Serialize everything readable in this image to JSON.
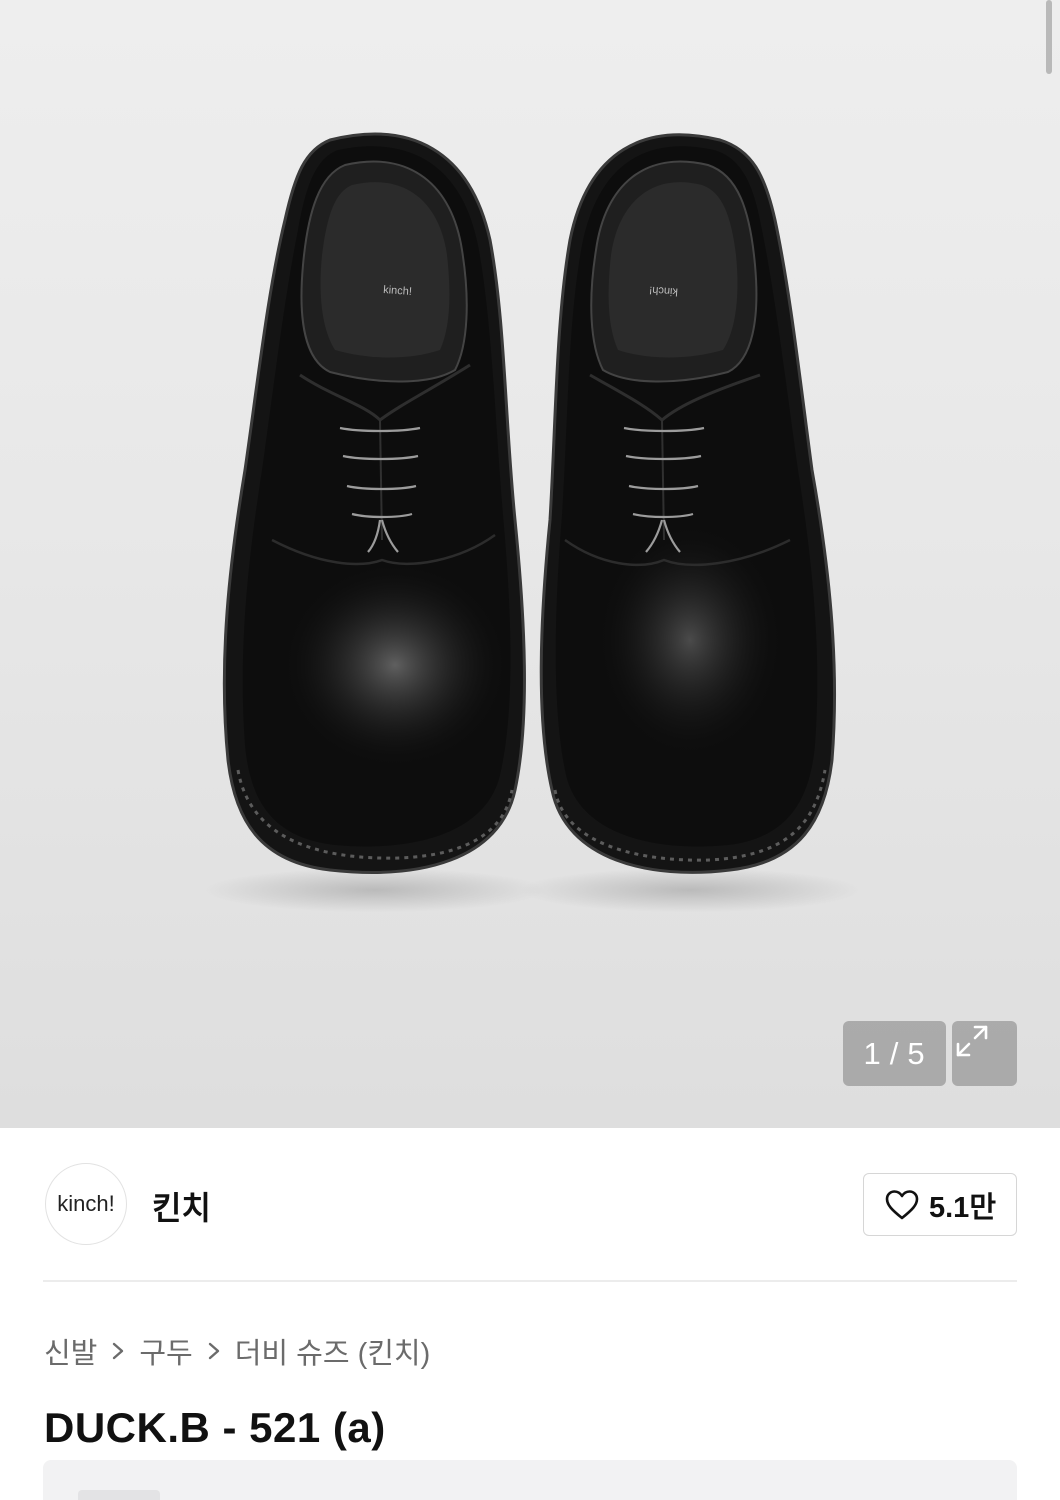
{
  "gallery": {
    "current": "1",
    "separator": "/",
    "total": "5",
    "product_mark_left": "kinch!",
    "product_mark_right": "kinch!"
  },
  "brand": {
    "logo_text": "kinch!",
    "name": "킨치",
    "like_count": "5.1만"
  },
  "breadcrumb": [
    "신발",
    "구두",
    "더비 슈즈 (킨치)"
  ],
  "product": {
    "title": "DUCK.B - 521 (a)"
  },
  "icons": {
    "expand": "expand-arrows-icon",
    "like": "heart-outline-icon",
    "breadcrumb_separator": "chevron-right-icon"
  },
  "colors": {
    "hero_background": "#e9e9e9",
    "overlay": "#969696",
    "text_primary": "#111111",
    "text_secondary": "#6b6b6b",
    "divider": "#ececec"
  }
}
